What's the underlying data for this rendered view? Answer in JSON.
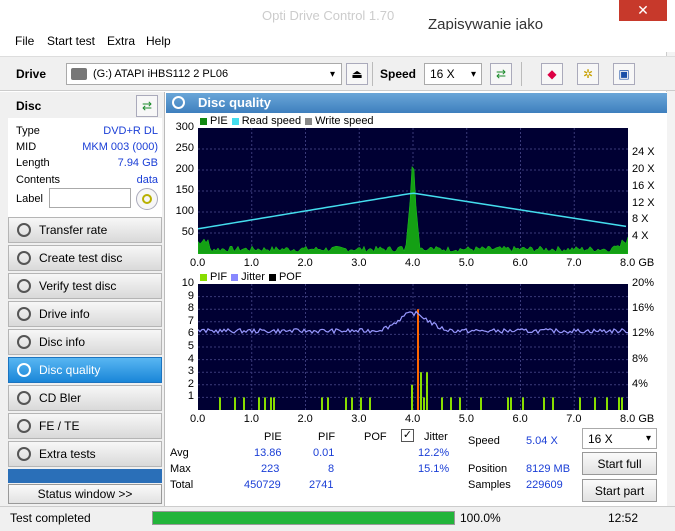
{
  "window": {
    "ghost_title": "Opti Drive Control 1.70",
    "saveas": "Zapisywanie jako",
    "close_glyph": "✕"
  },
  "menu": [
    "File",
    "Start test",
    "Extra",
    "Help"
  ],
  "toolbar": {
    "drive_label": "Drive",
    "drive_value": "(G:)   ATAPI iHBS112   2 PL06",
    "speed_label": "Speed",
    "speed_value": "16 X"
  },
  "sidebar": {
    "title": "Disc",
    "props": [
      {
        "k": "Type",
        "v": "DVD+R DL"
      },
      {
        "k": "MID",
        "v": "MKM 003 (000)"
      },
      {
        "k": "Length",
        "v": "7.94 GB"
      },
      {
        "k": "Contents",
        "v": "data"
      }
    ],
    "label_key": "Label",
    "label_value": "",
    "nav": [
      "Transfer rate",
      "Create test disc",
      "Verify test disc",
      "Drive info",
      "Disc info",
      "Disc quality",
      "CD Bler",
      "FE / TE",
      "Extra tests"
    ],
    "status_window": "Status window >>"
  },
  "panel": {
    "title": "Disc quality"
  },
  "chart_data": [
    {
      "type": "area",
      "legend": [
        {
          "name": "PIE",
          "color": "#118811"
        },
        {
          "name": "Read speed",
          "color": "#44ddee"
        },
        {
          "name": "Write speed",
          "color": "#888888"
        }
      ],
      "x_ticks": [
        "0.0",
        "1.0",
        "2.0",
        "3.0",
        "4.0",
        "5.0",
        "6.0",
        "7.0",
        "8.0 GB"
      ],
      "y_ticks_left": [
        "300",
        "250",
        "200",
        "150",
        "100",
        "50"
      ],
      "y_ticks_right": [
        "24 X",
        "20 X",
        "16 X",
        "12 X",
        "8 X",
        "4 X"
      ],
      "ylim": [
        0,
        300
      ],
      "xlim": [
        0,
        8.0
      ],
      "pie_peak": {
        "x": 4.0,
        "y": 223
      }
    },
    {
      "type": "bar",
      "legend": [
        {
          "name": "PIF",
          "color": "#88dd00"
        },
        {
          "name": "Jitter",
          "color": "#8888ff"
        },
        {
          "name": "POF",
          "color": "#000000"
        }
      ],
      "x_ticks": [
        "0.0",
        "1.0",
        "2.0",
        "3.0",
        "4.0",
        "5.0",
        "6.0",
        "7.0",
        "8.0 GB"
      ],
      "y_ticks_left": [
        "10",
        "9",
        "8",
        "7",
        "6",
        "5",
        "4",
        "3",
        "2",
        "1"
      ],
      "y_ticks_right": [
        "20%",
        "16%",
        "12%",
        "8%",
        "4%"
      ],
      "ylim": [
        0,
        10
      ],
      "xlim": [
        0,
        8.0
      ],
      "pif_peak": {
        "x": 4.05,
        "y": 8
      }
    }
  ],
  "stats": {
    "headers": [
      "PIE",
      "PIF",
      "POF",
      "Jitter"
    ],
    "rows": [
      {
        "label": "Avg",
        "pie": "13.86",
        "pif": "0.01",
        "pof": "",
        "jitter": "12.2%"
      },
      {
        "label": "Max",
        "pie": "223",
        "pif": "8",
        "pof": "",
        "jitter": "15.1%"
      },
      {
        "label": "Total",
        "pie": "450729",
        "pif": "2741",
        "pof": "",
        "jitter": ""
      }
    ],
    "jitter_checked": "✓",
    "speed_label": "Speed",
    "speed_value": "5.04 X",
    "position_label": "Position",
    "position_value": "8129 MB",
    "samples_label": "Samples",
    "samples_value": "229609",
    "speed_select": "16 X",
    "start_full": "Start full",
    "start_part": "Start part"
  },
  "statusbar": {
    "text": "Test completed",
    "progress": 1.0,
    "percent": "100.0%",
    "time": "12:52"
  }
}
